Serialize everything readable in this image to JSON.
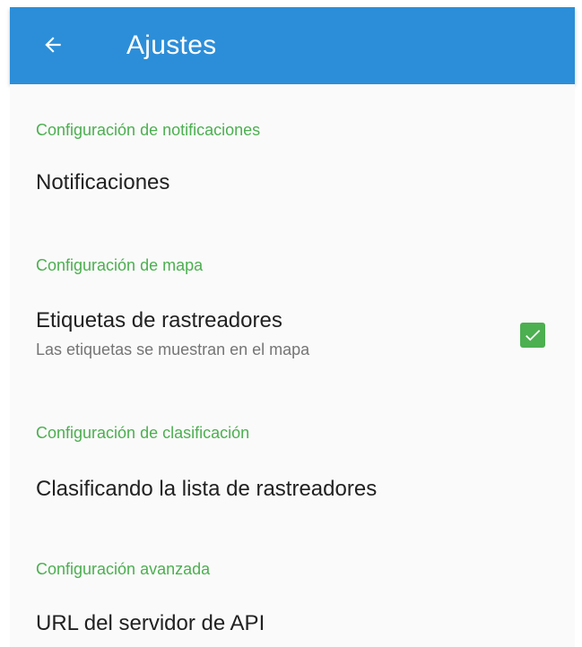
{
  "app_bar": {
    "title": "Ajustes",
    "back_icon": "arrow-back-icon",
    "background_color": "#2c8ed8"
  },
  "sections": [
    {
      "header": "Configuración de notificaciones",
      "items": [
        {
          "title": "Notificaciones"
        }
      ]
    },
    {
      "header": "Configuración de mapa",
      "items": [
        {
          "title": "Etiquetas de rastreadores",
          "summary": "Las etiquetas se muestran en el mapa",
          "checked": true,
          "checkbox_icon": "check-icon"
        }
      ]
    },
    {
      "header": "Configuración de clasificación",
      "items": [
        {
          "title": "Clasificando la lista de rastreadores"
        }
      ]
    },
    {
      "header": "Configuración avanzada",
      "items": [
        {
          "title": "URL del servidor de API"
        }
      ]
    }
  ],
  "colors": {
    "accent": "#4caf50",
    "primary_text": "#212121",
    "secondary_text": "#757575"
  }
}
